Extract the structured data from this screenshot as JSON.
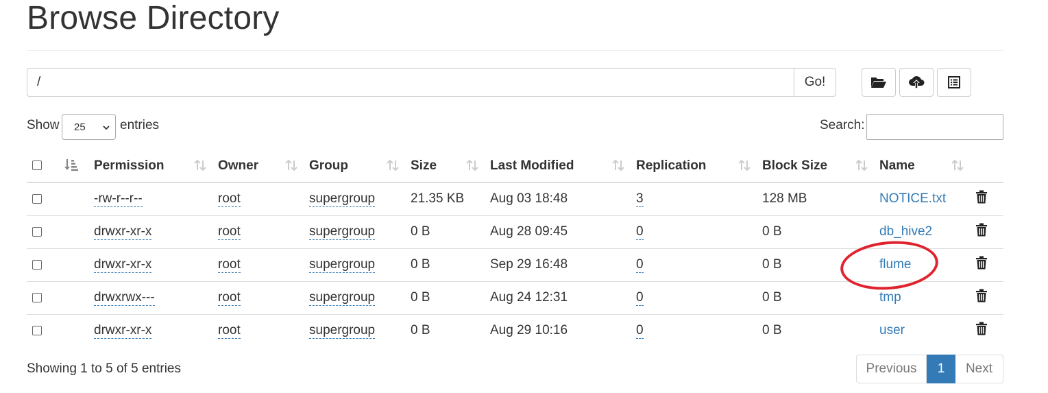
{
  "page": {
    "title": "Browse Directory"
  },
  "path_bar": {
    "value": "/",
    "go_label": "Go!"
  },
  "toolbar": {
    "icons": [
      "folder-open-icon",
      "cloud-upload-icon",
      "list-icon"
    ]
  },
  "controls": {
    "show_label": "Show",
    "entries_value": "25",
    "entries_label": "entries",
    "search_label": "Search:"
  },
  "table": {
    "headers": [
      "Permission",
      "Owner",
      "Group",
      "Size",
      "Last Modified",
      "Replication",
      "Block Size",
      "Name"
    ],
    "rows": [
      {
        "permission": "-rw-r--r--",
        "owner": "root",
        "group": "supergroup",
        "size": "21.35 KB",
        "modified": "Aug 03 18:48",
        "replication": "3",
        "block_size": "128 MB",
        "name": "NOTICE.txt"
      },
      {
        "permission": "drwxr-xr-x",
        "owner": "root",
        "group": "supergroup",
        "size": "0 B",
        "modified": "Aug 28 09:45",
        "replication": "0",
        "block_size": "0 B",
        "name": "db_hive2"
      },
      {
        "permission": "drwxr-xr-x",
        "owner": "root",
        "group": "supergroup",
        "size": "0 B",
        "modified": "Sep 29 16:48",
        "replication": "0",
        "block_size": "0 B",
        "name": "flume"
      },
      {
        "permission": "drwxrwx---",
        "owner": "root",
        "group": "supergroup",
        "size": "0 B",
        "modified": "Aug 24 12:31",
        "replication": "0",
        "block_size": "0 B",
        "name": "tmp"
      },
      {
        "permission": "drwxr-xr-x",
        "owner": "root",
        "group": "supergroup",
        "size": "0 B",
        "modified": "Aug 29 10:16",
        "replication": "0",
        "block_size": "0 B",
        "name": "user"
      }
    ]
  },
  "footer": {
    "info": "Showing 1 to 5 of 5 entries",
    "previous": "Previous",
    "current_page": "1",
    "next": "Next"
  },
  "colors": {
    "link": "#337ab7",
    "annotation": "#e0242f",
    "active_page": "#337ab7"
  }
}
